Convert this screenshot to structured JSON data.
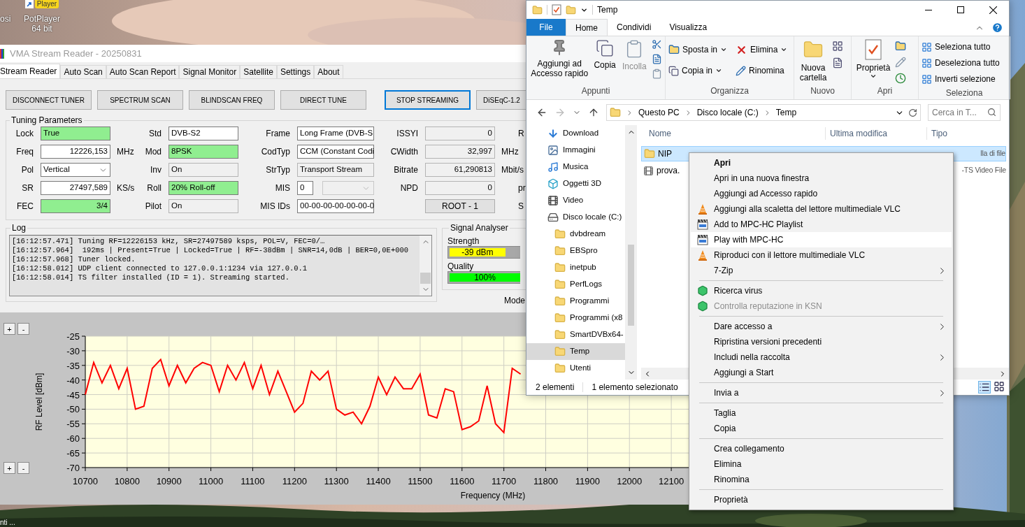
{
  "desktop": {
    "icons": [
      {
        "label": "osi"
      },
      {
        "label": "PotPlayer 64 bit",
        "tile_text": "Player"
      }
    ],
    "taskbar_text": "nti ..."
  },
  "vma": {
    "title": "VMA Stream Reader - 20250831",
    "tabs": [
      {
        "label": "Stream Reader",
        "selected": true
      },
      {
        "label": "Auto Scan",
        "selected": false
      },
      {
        "label": "Auto Scan Report",
        "selected": false
      },
      {
        "label": "Signal Monitor",
        "selected": false
      },
      {
        "label": "Satellite",
        "selected": false
      },
      {
        "label": "Settings",
        "selected": false
      },
      {
        "label": "About",
        "selected": false
      }
    ],
    "buttons": [
      {
        "label": "DISCONNECT TUNER",
        "focused": false
      },
      {
        "label": "SPECTRUM SCAN",
        "focused": false
      },
      {
        "label": "BLINDSCAN FREQ",
        "focused": false
      },
      {
        "label": "DIRECT TUNE",
        "focused": false
      },
      {
        "label": "STOP STREAMING",
        "focused": true
      },
      {
        "label": "DiSEqC-1.2",
        "focused": false
      }
    ],
    "tuning": {
      "title": "Tuning Parameters",
      "columns": [
        {
          "fields": [
            {
              "label": "Lock",
              "value": "True",
              "kind": "text",
              "highlight": true,
              "readonly": false
            },
            {
              "label": "Freq",
              "value": "12226,153",
              "kind": "number",
              "highlight": false,
              "readonly": false,
              "unit": "MHz"
            },
            {
              "label": "Pol",
              "value": "Vertical",
              "kind": "combo",
              "highlight": false,
              "readonly": false
            },
            {
              "label": "SR",
              "value": "27497,589",
              "kind": "number",
              "highlight": false,
              "readonly": false,
              "unit": "KS/s"
            },
            {
              "label": "FEC",
              "value": "3/4",
              "kind": "number",
              "highlight": true,
              "readonly": false
            }
          ]
        },
        {
          "fields": [
            {
              "label": "Std",
              "value": "DVB-S2",
              "kind": "text",
              "highlight": false,
              "readonly": false
            },
            {
              "label": "Mod",
              "value": "8PSK",
              "kind": "text",
              "highlight": true,
              "readonly": false
            },
            {
              "label": "Inv",
              "value": "On",
              "kind": "text",
              "highlight": false,
              "readonly": true
            },
            {
              "label": "Roll",
              "value": "20% Roll-off",
              "kind": "text",
              "highlight": true,
              "readonly": false
            },
            {
              "label": "Pilot",
              "value": "On",
              "kind": "text",
              "highlight": false,
              "readonly": true
            }
          ]
        },
        {
          "fields": [
            {
              "label": "Frame",
              "value": "Long Frame (DVB-S",
              "kind": "text",
              "highlight": false,
              "readonly": false
            },
            {
              "label": "CodTyp",
              "value": "CCM (Constant Codi",
              "kind": "text",
              "highlight": false,
              "readonly": false
            },
            {
              "label": "StrTyp",
              "value": "Transport Stream",
              "kind": "text",
              "highlight": false,
              "readonly": true
            },
            {
              "label": "MIS",
              "value": "0",
              "kind": "mis",
              "highlight": false,
              "readonly": false
            },
            {
              "label": "MIS IDs",
              "value": "00-00-00-00-00-00-0",
              "kind": "text",
              "highlight": false,
              "readonly": false
            }
          ]
        },
        {
          "fields": [
            {
              "label": "ISSYI",
              "value": "0",
              "kind": "number",
              "highlight": false,
              "readonly": true,
              "next_label": "R"
            },
            {
              "label": "CWidth",
              "value": "32,997",
              "kind": "number",
              "highlight": false,
              "readonly": true,
              "unit": "MHz"
            },
            {
              "label": "Bitrate",
              "value": "61,290813",
              "kind": "number",
              "highlight": false,
              "readonly": true,
              "unit": "Mbit/s"
            },
            {
              "label": "NPD",
              "value": "0",
              "kind": "number",
              "highlight": false,
              "readonly": true,
              "next_label": "pr"
            },
            {
              "value": "ROOT - 1",
              "kind": "button",
              "next_label": "S"
            }
          ]
        }
      ]
    },
    "log": {
      "title": "Log",
      "lines": [
        "[16:12:57.471] Tuning RF=12226153 kHz, SR=27497589 ksps, POL=V, FEC=0/…",
        "[16:12:57.964]  192ms | Present=True | Locked=True | RF=-38dBm | SNR=14,0dB | BER=0,0E+000",
        "[16:12:57.968] Tuner locked.",
        "[16:12:58.012] UDP client connected to 127.0.0.1:1234 via 127.0.0.1",
        "[16:12:58.014] TS filter installed (ID = 1). Streaming started."
      ]
    },
    "signal": {
      "title": "Signal Analyser",
      "meters": [
        {
          "label": "Strength",
          "reading": "-39 dBm",
          "level": 0.79,
          "color": "#ffff00"
        },
        {
          "label": "Quality",
          "reading": "100%",
          "level": 1,
          "color": "#00ff00"
        }
      ],
      "mode_label": "Mode"
    },
    "chart_panel": {
      "zoom_top": [
        "+",
        "-"
      ],
      "zoom_bottom": [
        "+",
        "-"
      ],
      "chart_data": {
        "type": "line",
        "xlabel": "Frequency (MHz)",
        "ylabel": "RF Level [dBm]",
        "grid": true,
        "xlim": [
          10700,
          12180
        ],
        "ylim": [
          -70,
          -25
        ],
        "xticks": [
          10700,
          10800,
          10900,
          11000,
          11100,
          11200,
          11300,
          11400,
          11500,
          11600,
          11700,
          11800,
          11900,
          12000,
          12100
        ],
        "yticks": [
          -25,
          -30,
          -35,
          -40,
          -45,
          -50,
          -55,
          -60,
          -65,
          -70
        ],
        "x": [
          10700,
          10720,
          10740,
          10760,
          10780,
          10800,
          10820,
          10840,
          10860,
          10880,
          10900,
          10920,
          10940,
          10960,
          10980,
          11000,
          11020,
          11040,
          11060,
          11080,
          11100,
          11120,
          11140,
          11160,
          11180,
          11200,
          11220,
          11240,
          11260,
          11280,
          11300,
          11320,
          11340,
          11360,
          11380,
          11400,
          11420,
          11440,
          11460,
          11480,
          11500,
          11520,
          11540,
          11560,
          11580,
          11600,
          11620,
          11640,
          11660,
          11680,
          11700,
          11720,
          11740
        ],
        "series": [
          {
            "color": "#ff0000",
            "values": [
              -45,
              -34,
              -41,
              -35,
              -43,
              -36,
              -50,
              -49,
              -36,
              -33,
              -42,
              -35,
              -41,
              -36,
              -34,
              -35,
              -44,
              -35,
              -40,
              -34,
              -43,
              -35,
              -45,
              -37,
              -44,
              -51,
              -48,
              -37,
              -40,
              -37,
              -50,
              -52,
              -51,
              -55,
              -49,
              -39,
              -45,
              -39,
              -43,
              -43,
              -38,
              -52,
              -53,
              -43,
              -44,
              -57,
              -56,
              -54,
              -42,
              -55,
              -58,
              -36,
              -38
            ]
          }
        ]
      }
    }
  },
  "explorer": {
    "title": "Temp",
    "ribbon_tabs": [
      {
        "label": "File",
        "kind": "file",
        "selected": false
      },
      {
        "label": "Home",
        "kind": "tab",
        "selected": true
      },
      {
        "label": "Condividi",
        "kind": "tab",
        "selected": false
      },
      {
        "label": "Visualizza",
        "kind": "tab",
        "selected": false
      }
    ],
    "ribbon_groups": [
      {
        "label": "Appunti",
        "commands": [
          {
            "label": "Aggiungi ad Accesso rapido",
            "disabled": false,
            "has_menu": false
          },
          {
            "label": "Copia",
            "disabled": false,
            "has_menu": false
          },
          {
            "label": "Incolla",
            "disabled": true,
            "has_menu": false
          }
        ]
      },
      {
        "label": "Organizza",
        "commands": [
          {
            "label": "Sposta in",
            "disabled": false,
            "has_menu": true
          },
          {
            "label": "Copia in",
            "disabled": false,
            "has_menu": true
          },
          {
            "label": "Elimina",
            "disabled": false,
            "has_menu": true
          },
          {
            "label": "Rinomina",
            "disabled": false,
            "has_menu": false
          }
        ]
      },
      {
        "label": "Nuovo",
        "commands": [
          {
            "label": "Nuova cartella",
            "disabled": false,
            "has_menu": false
          }
        ]
      },
      {
        "label": "Apri",
        "commands": [
          {
            "label": "Proprietà",
            "disabled": false,
            "has_menu": true
          }
        ]
      },
      {
        "label": "Seleziona",
        "commands": [
          {
            "label": "Seleziona tutto",
            "disabled": false,
            "has_menu": false
          },
          {
            "label": "Deseleziona tutto",
            "disabled": false,
            "has_menu": false
          },
          {
            "label": "Inverti selezione",
            "disabled": false,
            "has_menu": false
          }
        ]
      }
    ],
    "breadcrumb": [
      "Questo PC",
      "Disco locale (C:)",
      "Temp"
    ],
    "search": {
      "placeholder": "Cerca in T..."
    },
    "nav": [
      {
        "label": "Download",
        "kind": "download",
        "selected": false
      },
      {
        "label": "Immagini",
        "kind": "pictures",
        "selected": false
      },
      {
        "label": "Musica",
        "kind": "music",
        "selected": false
      },
      {
        "label": "Oggetti 3D",
        "kind": "objects",
        "selected": false
      },
      {
        "label": "Video",
        "kind": "videos",
        "selected": false
      },
      {
        "label": "Disco locale (C:)",
        "kind": "drive",
        "selected": false,
        "children": [
          {
            "label": "dvbdream",
            "kind": "folder",
            "selected": false
          },
          {
            "label": "EBSpro",
            "kind": "folder",
            "selected": false
          },
          {
            "label": "inetpub",
            "kind": "folder",
            "selected": false
          },
          {
            "label": "PerfLogs",
            "kind": "folder",
            "selected": false
          },
          {
            "label": "Programmi",
            "kind": "folder",
            "selected": false
          },
          {
            "label": "Programmi (x8",
            "kind": "folder",
            "selected": false
          },
          {
            "label": "SmartDVBx64-",
            "kind": "folder",
            "selected": false
          },
          {
            "label": "Temp",
            "kind": "folder",
            "selected": true
          },
          {
            "label": "Utenti",
            "kind": "folder",
            "selected": false
          }
        ]
      }
    ],
    "columns": [
      "Nome",
      "Ultima modifica",
      "Tipo"
    ],
    "files": [
      {
        "name": "NIP",
        "type": "lla di file",
        "kind": "folder",
        "selected": true
      },
      {
        "name": "prova.",
        "type": "-TS Video File",
        "kind": "video",
        "selected": false
      }
    ],
    "status": [
      "2 elementi",
      "1 elemento selezionato"
    ]
  },
  "context_menu": [
    {
      "kind": "plain",
      "label": "Apri",
      "bold": true,
      "highlighted": false,
      "disabled": false,
      "submenu": false
    },
    {
      "kind": "plain",
      "label": "Apri in una nuova finestra",
      "bold": false,
      "highlighted": false,
      "disabled": false,
      "submenu": false
    },
    {
      "kind": "plain",
      "label": "Aggiungi ad Accesso rapido",
      "bold": false,
      "highlighted": false,
      "disabled": false,
      "submenu": false
    },
    {
      "kind": "vlc",
      "label": "Aggiungi alla scaletta del lettore multimediale VLC",
      "bold": false,
      "highlighted": false,
      "disabled": false,
      "submenu": false
    },
    {
      "kind": "mpc",
      "label": "Add to MPC-HC Playlist",
      "bold": false,
      "highlighted": false,
      "disabled": false,
      "submenu": false
    },
    {
      "kind": "mpc",
      "label": "Play with MPC-HC",
      "bold": false,
      "highlighted": true,
      "disabled": false,
      "submenu": false
    },
    {
      "kind": "vlc",
      "label": "Riproduci con il lettore multimediale VLC",
      "bold": false,
      "highlighted": false,
      "disabled": false,
      "submenu": false
    },
    {
      "kind": "plain",
      "label": "7-Zip",
      "bold": false,
      "highlighted": false,
      "disabled": false,
      "submenu": true
    },
    {
      "kind": "separator"
    },
    {
      "kind": "av",
      "label": "Ricerca virus",
      "bold": false,
      "highlighted": false,
      "disabled": false,
      "submenu": false
    },
    {
      "kind": "av",
      "label": "Controlla reputazione in KSN",
      "bold": false,
      "highlighted": false,
      "disabled": true,
      "submenu": false
    },
    {
      "kind": "separator"
    },
    {
      "kind": "plain",
      "label": "Dare accesso a",
      "bold": false,
      "highlighted": false,
      "disabled": false,
      "submenu": true
    },
    {
      "kind": "plain",
      "label": "Ripristina versioni precedenti",
      "bold": false,
      "highlighted": false,
      "disabled": false,
      "submenu": false
    },
    {
      "kind": "plain",
      "label": "Includi nella raccolta",
      "bold": false,
      "highlighted": false,
      "disabled": false,
      "submenu": true
    },
    {
      "kind": "plain",
      "label": "Aggiungi a Start",
      "bold": false,
      "highlighted": false,
      "disabled": false,
      "submenu": false
    },
    {
      "kind": "separator"
    },
    {
      "kind": "plain",
      "label": "Invia a",
      "bold": false,
      "highlighted": false,
      "disabled": false,
      "submenu": true
    },
    {
      "kind": "separator"
    },
    {
      "kind": "plain",
      "label": "Taglia",
      "bold": false,
      "highlighted": false,
      "disabled": false,
      "submenu": false
    },
    {
      "kind": "plain",
      "label": "Copia",
      "bold": false,
      "highlighted": false,
      "disabled": false,
      "submenu": false
    },
    {
      "kind": "separator"
    },
    {
      "kind": "plain",
      "label": "Crea collegamento",
      "bold": false,
      "highlighted": false,
      "disabled": false,
      "submenu": false
    },
    {
      "kind": "plain",
      "label": "Elimina",
      "bold": false,
      "highlighted": false,
      "disabled": false,
      "submenu": false
    },
    {
      "kind": "plain",
      "label": "Rinomina",
      "bold": false,
      "highlighted": false,
      "disabled": false,
      "submenu": false
    },
    {
      "kind": "separator"
    },
    {
      "kind": "plain",
      "label": "Proprietà",
      "bold": false,
      "highlighted": false,
      "disabled": false,
      "submenu": false
    }
  ]
}
